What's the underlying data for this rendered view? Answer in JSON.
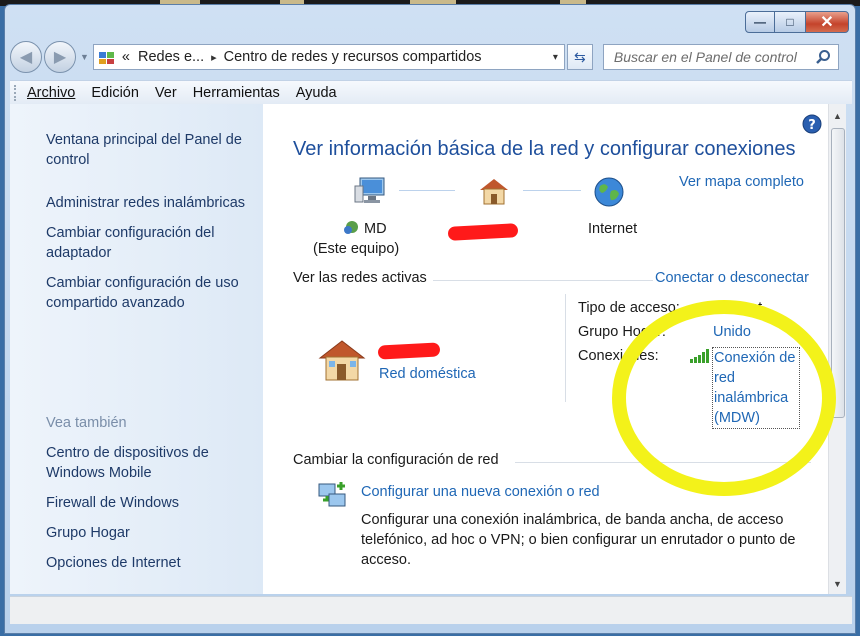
{
  "window": {
    "minimize_glyph": "—",
    "maximize_glyph": "□",
    "close_glyph": "✕"
  },
  "address": {
    "crumb_prefix": "«",
    "crumb1": "Redes e...",
    "separator": "▸",
    "crumb2": "Centro de redes y recursos compartidos",
    "dropdown_glyph": "▾",
    "search_placeholder": "Buscar en el Panel de control"
  },
  "menu": [
    "Archivo",
    "Edición",
    "Ver",
    "Herramientas",
    "Ayuda"
  ],
  "sidebar": {
    "links": [
      "Ventana principal del Panel de control",
      "Administrar redes inalámbricas",
      "Cambiar configuración del adaptador",
      "Cambiar configuración de uso compartido avanzado"
    ],
    "see_also_label": "Vea también",
    "see_also": [
      "Centro de dispositivos de Windows Mobile",
      "Firewall de Windows",
      "Grupo Hogar",
      "Opciones de Internet"
    ]
  },
  "main": {
    "title": "Ver información básica de la red y configurar conexiones",
    "full_map": "Ver mapa completo",
    "computer_name": "MD",
    "computer_sub": "(Este equipo)",
    "internet_label": "Internet",
    "active_networks": "Ver las redes activas",
    "connect_disconnect": "Conectar o desconectar",
    "network_type": "Red doméstica",
    "access_type_label": "Tipo de acceso:",
    "access_type_value": "Internet",
    "homegroup_label": "Grupo Hogar:",
    "homegroup_value": "Unido",
    "connections_label": "Conexiones:",
    "connection_value": "Conexión de red inalámbrica (MDW)",
    "change_settings": "Cambiar la configuración de red",
    "task1_title": "Configurar una nueva conexión o red",
    "task1_desc": "Configurar una conexión inalámbrica, de banda ancha, de acceso telefónico, ad hoc o VPN; o bien configurar un enrutador o punto de acceso."
  },
  "colors": {
    "link": "#1f67b5",
    "title": "#1e4f9c",
    "highlight": "#f3f21a",
    "redaction": "#ff1a1a"
  }
}
